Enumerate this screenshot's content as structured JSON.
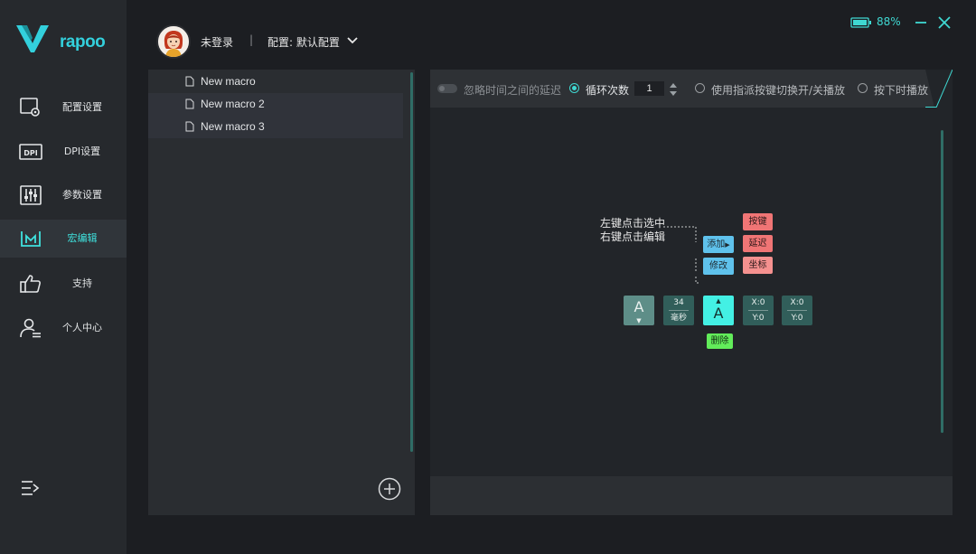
{
  "sidebar": {
    "brand": "rapoo",
    "items": [
      {
        "label": "配置设置",
        "icon": "settings-screen-icon"
      },
      {
        "label": "DPI设置",
        "icon": "dpi-icon"
      },
      {
        "label": "参数设置",
        "icon": "sliders-icon"
      },
      {
        "label": "宏编辑",
        "icon": "macro-icon",
        "active": true
      },
      {
        "label": "支持",
        "icon": "thumbs-up-icon"
      },
      {
        "label": "个人中心",
        "icon": "user-icon"
      }
    ]
  },
  "header": {
    "login_status": "未登录",
    "separator": "|",
    "config_label": "配置: 默认配置",
    "battery": "88%"
  },
  "macros": {
    "items": [
      "New macro",
      "New macro 2",
      "New macro 3"
    ]
  },
  "editor": {
    "options": {
      "ignore_delay": "忽略时间之间的延迟",
      "loop_count_label": "循环次数",
      "loop_count_value": "1",
      "toggle_play": "使用指派按键切换开/关播放",
      "hold_play": "按下时播放"
    },
    "hint": {
      "line1": "左键点击选中",
      "line2": "右键点击编辑"
    },
    "actions": {
      "add": "添加",
      "modify": "修改",
      "key": "按键",
      "delay": "延迟",
      "coordinate": "坐标",
      "delete": "删除"
    },
    "nodes": {
      "key1": "A",
      "delay_value": "34",
      "delay_unit": "毫秒",
      "key2": "A",
      "coord1_x": "X:0",
      "coord1_y": "Y:0",
      "coord2_x": "X:0",
      "coord2_y": "Y:0"
    }
  },
  "colors": {
    "accent": "#3fd8d2",
    "sidebar_bg": "#26292d",
    "panel_bg": "#2a2d31",
    "delete": "#62ec5a",
    "add": "#5fc2ec",
    "insert_type": "#f07575"
  }
}
